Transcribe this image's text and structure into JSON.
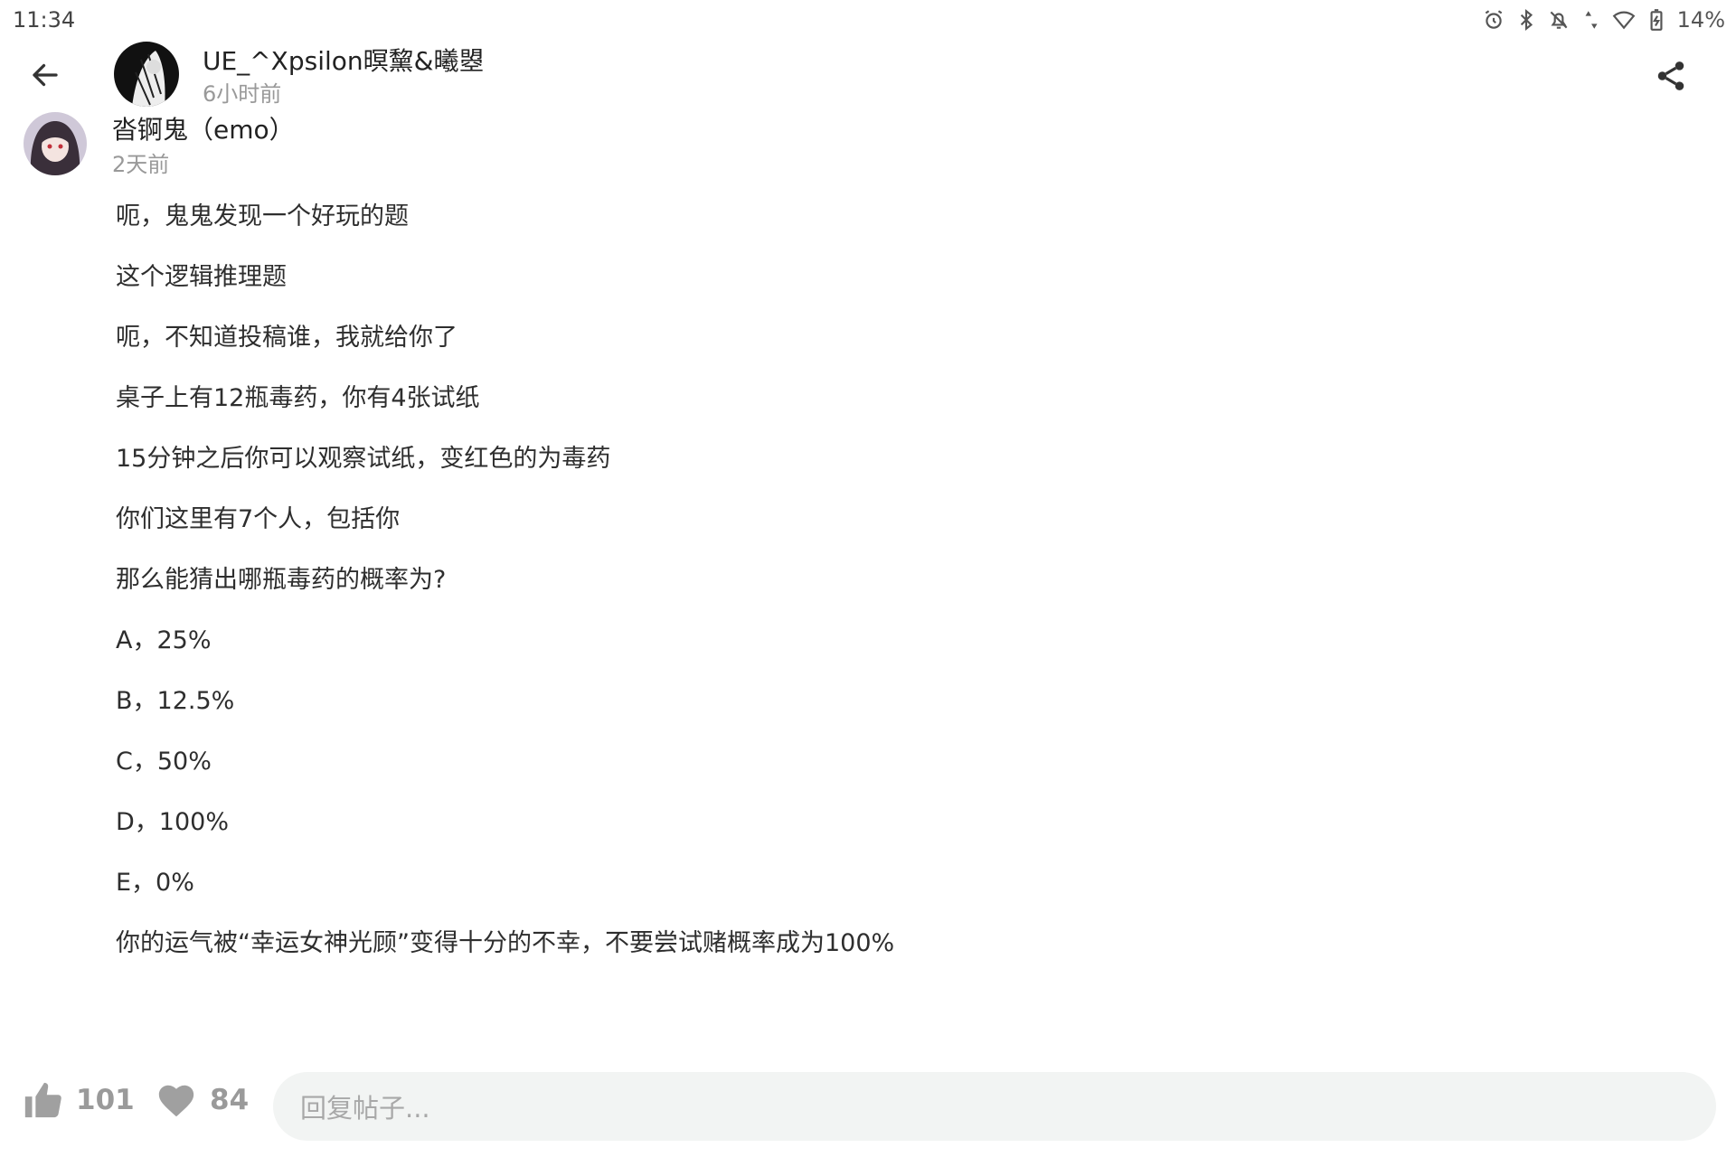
{
  "status_bar": {
    "time": "11:34",
    "icons": [
      "alarm-icon",
      "bluetooth-icon",
      "notifications-off-icon",
      "data-arrows-icon",
      "wifi-icon",
      "battery-icon"
    ],
    "battery": "14%"
  },
  "header": {
    "author_name": "UE_^Xpsilon暝黧&曦曌",
    "time": "6小时前"
  },
  "comment": {
    "author_name": "沓锕鬼（emo）",
    "time": "2天前",
    "lines": [
      "呃，鬼鬼发现一个好玩的题",
      "这个逻辑推理题",
      "呃，不知道投稿谁，我就给你了",
      "桌子上有12瓶毒药，你有4张试纸",
      "15分钟之后你可以观察试纸，变红色的为毒药",
      "你们这里有7个人，包括你",
      "那么能猜出哪瓶毒药的概率为?",
      "A，25%",
      "B，12.5%",
      "C，50%",
      "D，100%",
      "E，0%",
      "你的运气被“幸运女神光顾”变得十分的不幸，不要尝试赌概率成为100%"
    ]
  },
  "footer": {
    "like_count": "101",
    "favorite_count": "84",
    "reply_placeholder": "回复帖子..."
  },
  "colors": {
    "secondary_text": "#999999",
    "reply_box_bg": "#f2f4f3",
    "icon_gray": "#9a9a9a"
  }
}
